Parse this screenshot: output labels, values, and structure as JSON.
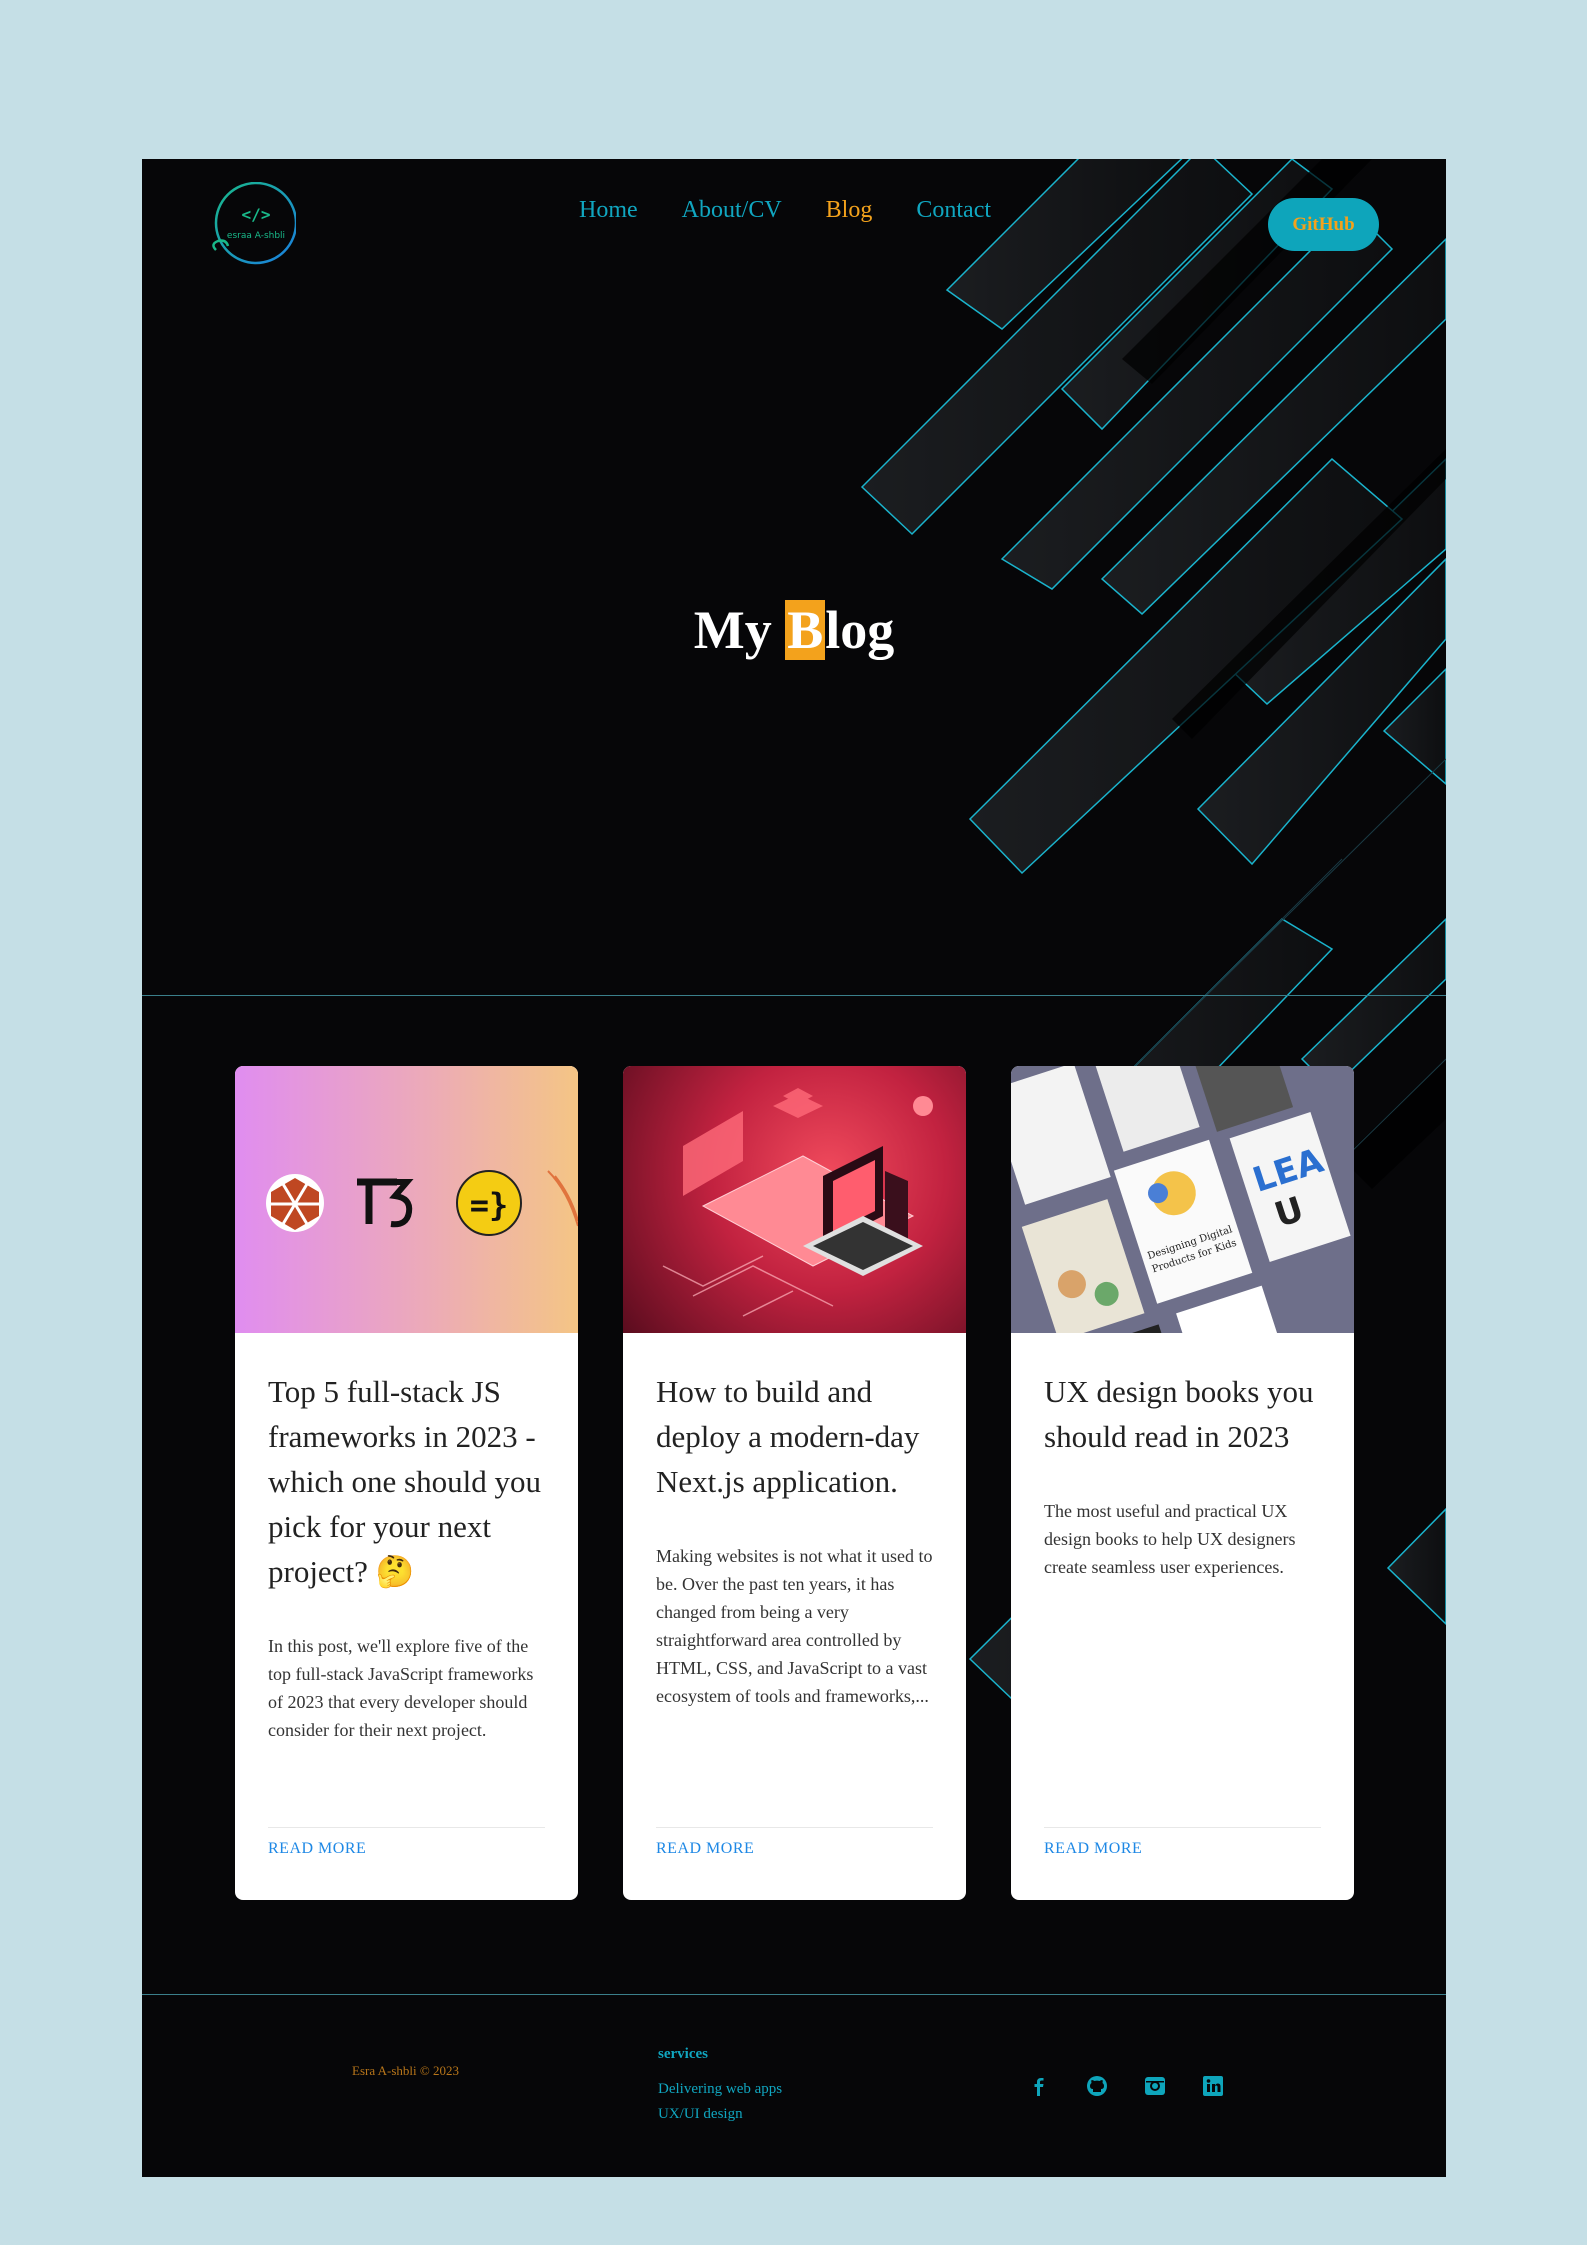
{
  "colors": {
    "background": "#c5dfe6",
    "page": "#060608",
    "accent_cyan": "#0ea5bb",
    "accent_orange": "#f3a21c",
    "link_blue": "#1e88e5"
  },
  "header": {
    "logo": {
      "icon": "code-brackets-icon",
      "text": "esraa A-shbli"
    },
    "nav": [
      {
        "label": "Home",
        "active": false
      },
      {
        "label": "About/CV",
        "active": false
      },
      {
        "label": "Blog",
        "active": true
      },
      {
        "label": "Contact",
        "active": false
      }
    ],
    "github_label": "GitHub"
  },
  "hero": {
    "title_before": "My ",
    "title_highlight": "B",
    "title_after": "log"
  },
  "posts": [
    {
      "image_icons": [
        "redwood-icon",
        "t3-icon",
        "blitz-icon"
      ],
      "title": "Top 5 full-stack JS frameworks in 2023 - which one should you pick for your next project? 🤔",
      "excerpt": "In this post, we'll explore five of the top full-stack JavaScript frameworks of 2023 that every developer should consider for their next project.",
      "read_more": "READ MORE"
    },
    {
      "image_icons": [
        "isometric-laptop-illustration"
      ],
      "title": "How to build and deploy a modern-day Next.js application.",
      "excerpt": "Making websites is not what it used to be. Over the past ten years, it has changed from being a very straightforward area controlled by HTML, CSS, and JavaScript to a vast ecosystem of tools and frameworks,...",
      "read_more": "READ MORE"
    },
    {
      "image_icons": [
        "ux-books-photo"
      ],
      "title": "UX design books you should read in 2023",
      "excerpt": "The most useful and practical UX design books to help UX designers create seamless user experiences.",
      "read_more": "READ MORE"
    }
  ],
  "footer": {
    "copyright": "Esra A-shbli © 2023",
    "services_heading": "services",
    "services": [
      "Delivering web apps",
      "UX/UI design"
    ],
    "social_icons": [
      "facebook-icon",
      "github-icon",
      "instagram-icon",
      "linkedin-icon"
    ]
  }
}
